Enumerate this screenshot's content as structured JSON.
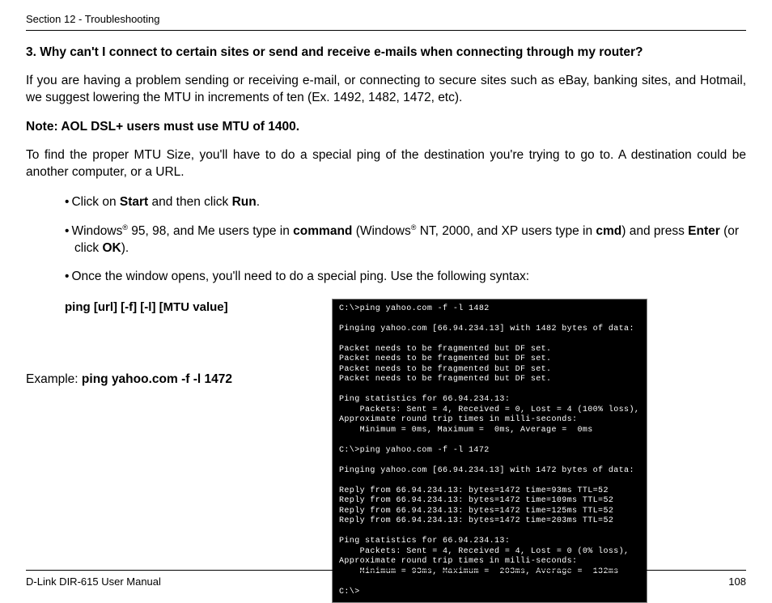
{
  "header": {
    "section": "Section 12 - Troubleshooting"
  },
  "question": {
    "title": "3. Why can't I connect to certain sites or send and receive e-mails when connecting through my router?",
    "p1": "If you are having a problem sending or receiving e-mail, or connecting to secure sites such as eBay, banking sites, and Hotmail, we suggest lowering the MTU in increments of ten (Ex. 1492, 1482, 1472, etc).",
    "note": "Note: AOL DSL+ users must use MTU of 1400.",
    "p2": "To find the proper MTU Size, you'll have to do a special ping of the destination you're trying to go to. A destination could be another computer, or a URL."
  },
  "bullets": {
    "b1_pre": "Click on ",
    "b1_start": "Start",
    "b1_mid": " and then click ",
    "b1_run": "Run",
    "b1_post": ".",
    "b2_pre": "Windows",
    "b2_reg": "®",
    "b2_mid1": " 95, 98, and Me users type in ",
    "b2_cmd1": "command",
    "b2_mid2": " (Windows",
    "b2_mid3": " NT, 2000, and XP users type in ",
    "b2_cmd2": "cmd",
    "b2_mid4": ") and press ",
    "b2_enter": "Enter",
    "b2_mid5": " (or click ",
    "b2_ok": "OK",
    "b2_post": ").",
    "b3": "Once the window opens, you'll need to do a special ping. Use the following syntax:"
  },
  "syntax": {
    "line": "ping [url] [-f] [-l] [MTU value]"
  },
  "example": {
    "label": "Example: ",
    "cmd": "ping yahoo.com -f -l 1472"
  },
  "terminal": {
    "text": "C:\\>ping yahoo.com -f -l 1482\n\nPinging yahoo.com [66.94.234.13] with 1482 bytes of data:\n\nPacket needs to be fragmented but DF set.\nPacket needs to be fragmented but DF set.\nPacket needs to be fragmented but DF set.\nPacket needs to be fragmented but DF set.\n\nPing statistics for 66.94.234.13:\n    Packets: Sent = 4, Received = 0, Lost = 4 (100% loss),\nApproximate round trip times in milli-seconds:\n    Minimum = 0ms, Maximum =  0ms, Average =  0ms\n\nC:\\>ping yahoo.com -f -l 1472\n\nPinging yahoo.com [66.94.234.13] with 1472 bytes of data:\n\nReply from 66.94.234.13: bytes=1472 time=93ms TTL=52\nReply from 66.94.234.13: bytes=1472 time=109ms TTL=52\nReply from 66.94.234.13: bytes=1472 time=125ms TTL=52\nReply from 66.94.234.13: bytes=1472 time=203ms TTL=52\n\nPing statistics for 66.94.234.13:\n    Packets: Sent = 4, Received = 4, Lost = 0 (0% loss),\nApproximate round trip times in milli-seconds:\n    Minimum = 93ms, Maximum =  203ms, Average =  132ms\n\nC:\\>"
  },
  "footer": {
    "manual": "D-Link DIR-615 User Manual",
    "page": "108"
  }
}
